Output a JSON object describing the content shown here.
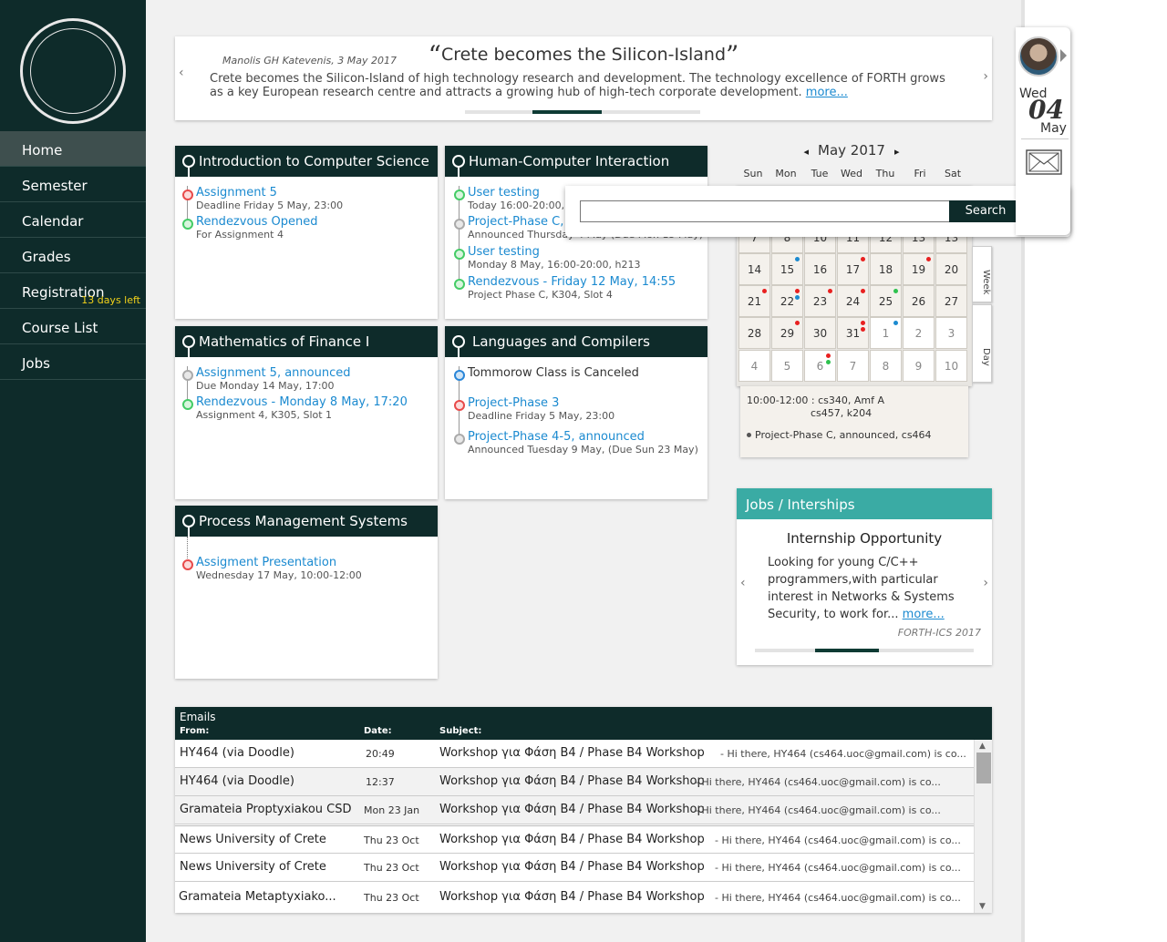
{
  "sidebar": {
    "items": [
      {
        "label": "Home",
        "sub": ""
      },
      {
        "label": "Semester",
        "sub": ""
      },
      {
        "label": "Calendar",
        "sub": ""
      },
      {
        "label": "Grades",
        "sub": ""
      },
      {
        "label": "Registration",
        "sub": "13 days left"
      },
      {
        "label": "Course List",
        "sub": ""
      },
      {
        "label": "Jobs",
        "sub": ""
      }
    ]
  },
  "news": {
    "title": "Crete becomes the Silicon-Island",
    "author": "Manolis GH Katevenis, 3 May 2017",
    "body": "Crete becomes the Silicon-Island of high technology research and development. The technology excellence of FORTH grows as a key European research centre and attracts a growing hub of high-tech corporate development.",
    "more": "more...",
    "prev": "‹",
    "next": "›"
  },
  "courses": [
    {
      "title": "Introduction to Computer Science",
      "items": [
        {
          "title": "Assignment 5",
          "sub": "Deadline Friday 5 May, 23:00",
          "color": "red"
        },
        {
          "title": "Rendezvous Opened",
          "sub": "For Assignment 4",
          "color": "green"
        }
      ]
    },
    {
      "title": "Human-Computer Interaction",
      "items": [
        {
          "title": "User testing",
          "sub": "Today 16:00-20:00, h",
          "color": "green"
        },
        {
          "title": "Project-Phase C, a",
          "sub": "Announced Thursday 4 May (Due Mon 15 May)",
          "color": "gray"
        },
        {
          "title": "User testing",
          "sub": "Monday 8 May, 16:00-20:00, h213",
          "color": "green"
        },
        {
          "title": "Rendezvous - Friday 12 May, 14:55",
          "sub": "Project Phase C, K304, Slot 4",
          "color": "green"
        }
      ]
    },
    {
      "title": "Mathematics of Finance I",
      "items": [
        {
          "title": "Assignment 5, announced",
          "sub": "Due Monday 14 May, 17:00",
          "color": "gray"
        },
        {
          "title": "Rendezvous - Monday 8 May, 17:20",
          "sub": "Assignment 4, K305, Slot 1",
          "color": "green"
        }
      ]
    },
    {
      "title": "Languages and Compilers",
      "items": [
        {
          "title": "Tommorow Class is Canceled",
          "sub": "",
          "color": "blue"
        },
        {
          "title": "Project-Phase 3",
          "sub": "Deadline Friday 5 May, 23:00",
          "color": "red"
        },
        {
          "title": "Project-Phase 4-5, announced",
          "sub": "Announced Tuesday 9 May, (Due Sun 23 May)",
          "color": "gray"
        }
      ]
    },
    {
      "title": "Process Management Systems",
      "items": [
        {
          "title": "Assigment Presentation",
          "sub": "Wednesday 17 May, 10:00-12:00",
          "color": "red"
        }
      ]
    }
  ],
  "calendar": {
    "month": "May 2017",
    "prev": "◂",
    "next": "▸",
    "dows": [
      "Sun",
      "Mon",
      "Tue",
      "Wed",
      "Thu",
      "Fri",
      "Sat"
    ],
    "rows": [
      [
        "7",
        "8",
        "10",
        "11",
        "12",
        "13",
        "13"
      ],
      [
        "14",
        "15",
        "16",
        "17",
        "18",
        "19",
        "20"
      ],
      [
        "21",
        "22",
        "23",
        "24",
        "25",
        "26",
        "27"
      ],
      [
        "28",
        "29",
        "30",
        "31",
        "1",
        "2",
        "3"
      ],
      [
        "4",
        "5",
        "6",
        "7",
        "8",
        "9",
        "10"
      ]
    ],
    "tabs": [
      "Week",
      "Day"
    ],
    "detail_l1": "10:00-12:00 : cs340, Amf A",
    "detail_l2": "cs457, k204",
    "detail_l3": "Project-Phase C, announced, cs464",
    "event_colors": {
      "red": "#e82020",
      "blue": "#1b8ad0",
      "green": "#2ec24e"
    }
  },
  "search": {
    "placeholder": "",
    "button": "Search"
  },
  "profile": {
    "dow": "Wed",
    "day": "04",
    "month": "May"
  },
  "jobs": {
    "header": "Jobs / Interships",
    "title": "Internship Opportunity",
    "body": "Looking for young C/C++ programmers,with particular interest in Networks & Systems Security, to work for...",
    "more": "more...",
    "source": "FORTH-ICS 2017",
    "prev": "‹",
    "next": "›"
  },
  "emails": {
    "title": "Emails",
    "col_from": "From:",
    "col_date": "Date:",
    "col_subject": "Subject:",
    "rows": [
      {
        "from": "HY464 (via Doodle)",
        "date": "20:49",
        "subject": "Workshop για Φάση Β4 / Phase B4 Workshop",
        "preview": "- Hi there, HY464 (cs464.uoc@gmail.com) is co..."
      },
      {
        "from": "HY464 (via Doodle)",
        "date": "12:37",
        "subject": "Workshop για Φάση Β4 / Phase B4 Workshop",
        "preview": "- Hi there, HY464 (cs464.uoc@gmail.com) is co..."
      },
      {
        "from": "Gramateia Proptyxiakou CSD",
        "date": "Mon 23 Jan",
        "subject": "Workshop για Φάση Β4 / Phase B4 Workshop",
        "preview": "- Hi there, HY464 (cs464.uoc@gmail.com) is co..."
      },
      {
        "from": "News University of Crete",
        "date": "Thu 23 Oct",
        "subject": "Workshop για Φάση Β4 / Phase B4 Workshop",
        "preview": "- Hi there, HY464 (cs464.uoc@gmail.com) is co..."
      },
      {
        "from": "News University of Crete",
        "date": "Thu 23 Oct",
        "subject": "Workshop για Φάση Β4 / Phase B4 Workshop",
        "preview": "- Hi there, HY464 (cs464.uoc@gmail.com) is co..."
      },
      {
        "from": "Gramateia Metaptyxiako...",
        "date": "Thu 23 Oct",
        "subject": "Workshop για Φάση Β4 / Phase B4 Workshop",
        "preview": "- Hi there, HY464 (cs464.uoc@gmail.com) is co..."
      }
    ]
  }
}
